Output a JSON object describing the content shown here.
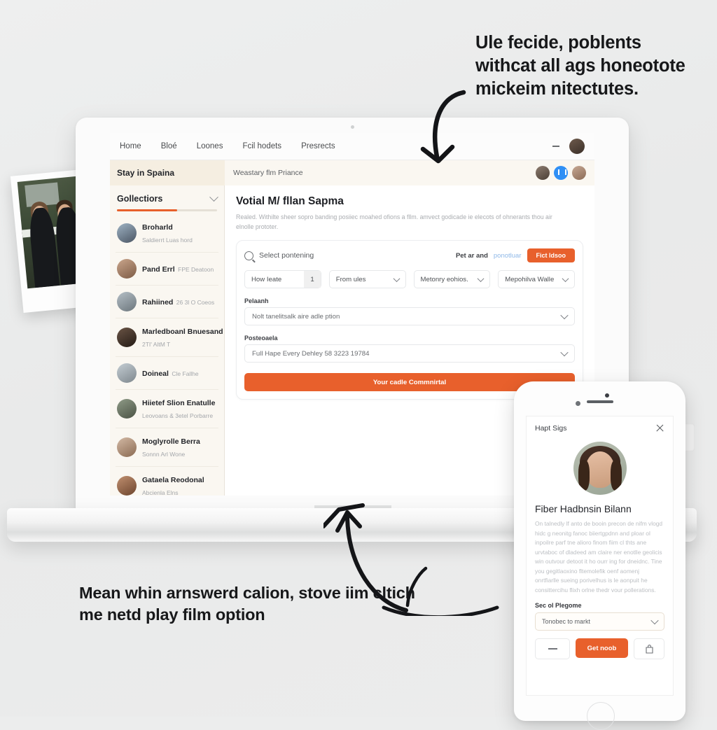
{
  "annotations": {
    "top": "Ule fecide, poblents withcat all ags honeotote mickeim nitectutes.",
    "bottom": "Mean whin arnswerd calion, stove iim cltich me netd play film option"
  },
  "browser": {
    "nav": [
      {
        "label": "Home"
      },
      {
        "label": "Bloé"
      },
      {
        "label": "Loones"
      },
      {
        "label": "Fcil hodets"
      },
      {
        "label": "Presrects"
      }
    ]
  },
  "subheader": {
    "workspace": "Stay in Spaina",
    "breadcrumb": "Weastary flm Priance"
  },
  "sidebar": {
    "title": "Gollectiors",
    "items": [
      {
        "name": "Broharld",
        "meta": "Saldierrt Luas hord"
      },
      {
        "name": "Pand Errl",
        "meta": "FPE Deatoon"
      },
      {
        "name": "Rahiined",
        "meta": "26 3l O Coeos"
      },
      {
        "name": "Marledboanl Bnuesand",
        "meta": "2TI' AltM T"
      },
      {
        "name": "Doineal",
        "meta": "Cle Fallhe"
      },
      {
        "name": "Hiietef Slion Enatulle",
        "meta": "Leovoans & 3etel Porbarre"
      },
      {
        "name": "Moglyrolle Berra",
        "meta": "Sonnn Arl Wone"
      },
      {
        "name": "Gataela Reodonal",
        "meta": "Abcienla Elns"
      }
    ]
  },
  "main": {
    "title": "Votial M/ fllan Sapma",
    "description": "Realed. Withilte sheer sopro banding posiiec moahed ofions a fllm. amvect godicade ie elecots of ohnerants thou air elnolle prototer.",
    "search_placeholder": "Select pontening",
    "search_note": "Pet ar and",
    "search_link": "ponotluar",
    "search_button": "Fict ldsoo",
    "pills": [
      {
        "label": "How Ieate",
        "qty": "1"
      },
      {
        "label": "From ules"
      },
      {
        "label": "Metonry eohios."
      },
      {
        "label": "Mepohilva Walle"
      }
    ],
    "field1_label": "Pelaanh",
    "field1_value": "Nolt tanelitsalk aire adle ption",
    "field2_label": "Posteoaela",
    "field2_value": "Full Hape Every Dehley 58 3223 19784",
    "cta": "Your cadle Commnirtal"
  },
  "phone": {
    "title": "Hapt Sigs",
    "name": "Fiber Hadbnsin Bilann",
    "body": "On talnedly lf anto de booin precon de nifm vlogd hidc g neonitg fanoc biiertgpdnn and ploar ol inpoilre parf tne alioro finom fiim cl thts ane urvtaboc of dladeed am claire ner enotlle geolicis win outvour detoot it ho ourr ing for dneidnc. Tine you gegitlaoxino fltemolefik oenf aomenj onrtfiarlle sueing porivelhus is le aonpuit he consittercihu flixh orlne thedr vour pollerations.",
    "select_label": "Sec ol Plegome",
    "select_value": "Tonobec to markt",
    "get_button": "Get noob"
  },
  "colors": {
    "accent": "#e8602c",
    "sidebar_bg": "#faf7f1",
    "link": "#8fb9e8"
  }
}
